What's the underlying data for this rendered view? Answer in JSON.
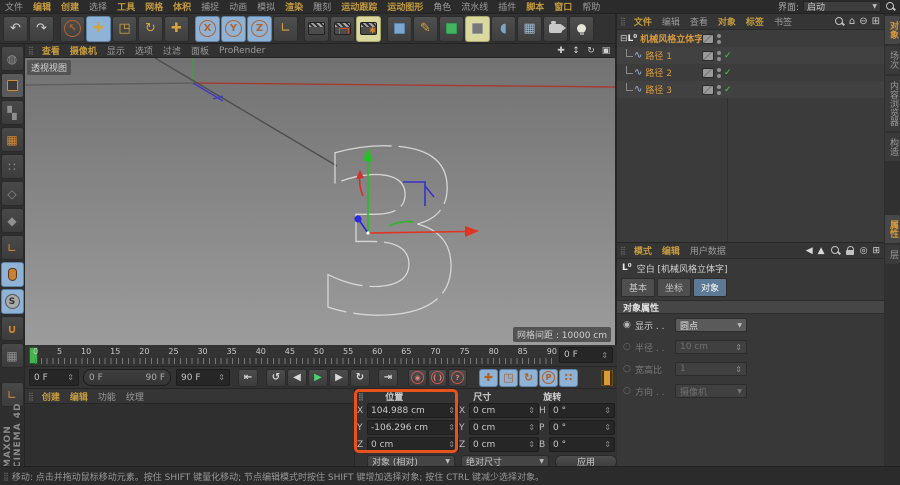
{
  "app_title": "Cinema 4D",
  "colors": {
    "accent_orange": "#e8521d",
    "highlight_blue": "#8fb3d6",
    "highlight_yellow": "#dada9f",
    "object_orange": "#d89b3c",
    "menu_highlight": "#c39a3f",
    "check_green": "#45d145",
    "play_green": "#49d16b",
    "axis_red": "#e03522",
    "axis_green": "#21c321",
    "axis_blue": "#2a2ad0"
  },
  "icons": {
    "dots_handle": "⣿",
    "dropdown": "▼",
    "spinner": "⇕",
    "undo": "↶",
    "redo": "↷",
    "live_select": "↖",
    "move": "✚",
    "scale": "◳",
    "rotate": "↻",
    "axis_x": "X",
    "axis_y": "Y",
    "axis_z": "Z",
    "coord_system": "∟",
    "pen": "✎",
    "bean": "◖",
    "floor": "▦",
    "make_editable": "◍",
    "texture_mode": "▚",
    "workplane": "▦",
    "points_mode": "∷",
    "edges_mode": "◇",
    "polygons_mode": "◆",
    "axis_mode": "∟",
    "snap_s": "S",
    "magnet": "∪",
    "workplane_lock": "▦",
    "axis_arrows": "∟",
    "pan": "✚",
    "dolly": "↕",
    "orbit": "↻",
    "maximize": "▣",
    "home": "⌂",
    "minus": "⊖",
    "add_panel": "⊞",
    "target": "◎",
    "back": "◀",
    "forward": "▲",
    "go_start": "⇤",
    "prev_key": "↺",
    "prev_frame": "◀",
    "play": "▶",
    "next_frame": "▶",
    "next_key": "↻",
    "go_end": "⇥",
    "record": "◉",
    "autokey": "( )",
    "help_key": "?",
    "lock_move": "✚",
    "lock_scale": "◳",
    "lock_rotate": "↻",
    "param_p": "P",
    "pla_dots": "∷",
    "expander": "⊟",
    "null_object": "L⁰",
    "spline": "∿",
    "check": "✓"
  },
  "menubar": {
    "items": [
      "文件",
      "编辑",
      "创建",
      "选择",
      "工具",
      "网格",
      "体积",
      "捕捉",
      "动画",
      "模拟",
      "渲染",
      "雕刻",
      "运动跟踪",
      "运动图形",
      "角色",
      "流水线",
      "插件",
      "脚本",
      "窗口",
      "帮助"
    ],
    "interface_label": "界面:",
    "interface_value": "启动"
  },
  "viewport": {
    "menu": [
      "查看",
      "摄像机",
      "显示",
      "选项",
      "过滤",
      "面板",
      "ProRender"
    ],
    "view_label": "透视视图",
    "grid_label": "网格间距 : 10000 cm",
    "spline_text": "3"
  },
  "object_manager": {
    "menu": [
      "文件",
      "编辑",
      "查看",
      "对象",
      "标签",
      "书签"
    ],
    "root_name": "机械风格立体字",
    "children": [
      {
        "name": "路径 1"
      },
      {
        "name": "路径 2"
      },
      {
        "name": "路径 3"
      }
    ]
  },
  "side_tabs_top": [
    "对象",
    "场次",
    "内容浏览器",
    "构造"
  ],
  "side_tabs_bottom": [
    "属性",
    "层"
  ],
  "attributes": {
    "menu": [
      "模式",
      "编辑",
      "用户数据"
    ],
    "title": "空白 [机械风格立体字]",
    "tabs": [
      "基本",
      "坐标",
      "对象"
    ],
    "active_tab": "对象",
    "section": "对象属性",
    "rows": [
      {
        "label": "显示 . .",
        "value": "圆点",
        "type": "dropdown",
        "enabled": true
      },
      {
        "label": "半径 . .",
        "value": "10 cm",
        "type": "spinner",
        "enabled": false
      },
      {
        "label": "宽高比",
        "value": "1",
        "type": "spinner",
        "enabled": false
      },
      {
        "label": "方向 . .",
        "value": "摄像机",
        "type": "dropdown",
        "enabled": false
      }
    ]
  },
  "timeline": {
    "ticks": [
      "0",
      "5",
      "10",
      "15",
      "20",
      "25",
      "30",
      "35",
      "40",
      "45",
      "50",
      "55",
      "60",
      "65",
      "70",
      "75",
      "80",
      "85",
      "90"
    ],
    "frame_field": "0 F",
    "current_frame": "0 F",
    "range_start": "0 F",
    "range_end": "90 F",
    "end_frame": "90 F"
  },
  "materials": {
    "menu": [
      "创建",
      "编辑",
      "功能",
      "纹理"
    ]
  },
  "coordinates": {
    "position": {
      "title": "位置",
      "x_label": "X",
      "x": "104.988 cm",
      "y_label": "Y",
      "y": "-106.296 cm",
      "z_label": "Z",
      "z": "0 cm",
      "mode": "对象 (相对)"
    },
    "size": {
      "title": "尺寸",
      "x_label": "X",
      "x": "0 cm",
      "y_label": "Y",
      "y": "0 cm",
      "z_label": "Z",
      "z": "0 cm",
      "mode": "绝对尺寸"
    },
    "rotation": {
      "title": "旋转",
      "h_label": "H",
      "h": "0 °",
      "p_label": "P",
      "p": "0 °",
      "b_label": "B",
      "b": "0 °",
      "apply": "应用"
    }
  },
  "statusbar": {
    "text": "移动: 点击并拖动鼠标移动元素。按住 SHIFT 键量化移动; 节点编辑模式时按住 SHIFT 键增加选择对象; 按住 CTRL 键减少选择对象。"
  },
  "branding": {
    "vertical_logo": "MAXON CINEMA 4D"
  }
}
